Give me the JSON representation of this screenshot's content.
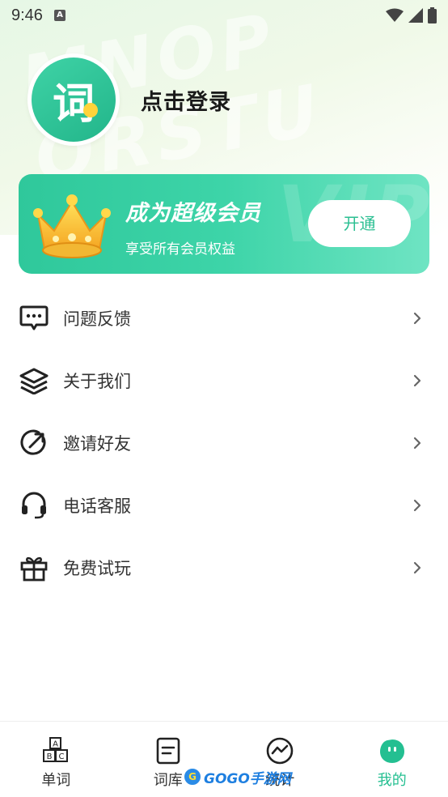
{
  "status_bar": {
    "time": "9:46",
    "notification_icon": "A"
  },
  "profile": {
    "avatar_glyph": "词",
    "login_label": "点击登录"
  },
  "vip": {
    "title": "成为超级会员",
    "subtitle": "享受所有会员权益",
    "button_label": "开通",
    "watermark": "VIP"
  },
  "background_letters": [
    "MNOP",
    "QRSTU"
  ],
  "menu": {
    "items": [
      {
        "label": "问题反馈",
        "icon": "feedback-icon"
      },
      {
        "label": "关于我们",
        "icon": "layers-icon"
      },
      {
        "label": "邀请好友",
        "icon": "share-icon"
      },
      {
        "label": "电话客服",
        "icon": "headset-icon"
      },
      {
        "label": "免费试玩",
        "icon": "gift-icon"
      }
    ]
  },
  "tabbar": {
    "tabs": [
      {
        "label": "单词",
        "icon": "abc-blocks-icon",
        "active": false
      },
      {
        "label": "词库",
        "icon": "book-icon",
        "active": false
      },
      {
        "label": "统计",
        "icon": "stats-icon",
        "active": false
      },
      {
        "label": "我的",
        "icon": "profile-face-icon",
        "active": true
      }
    ]
  },
  "watermark": {
    "text": "GOGO手游网"
  },
  "colors": {
    "accent": "#24bf91",
    "vip_start": "#2fc89b",
    "vip_end": "#6fe4c3"
  }
}
